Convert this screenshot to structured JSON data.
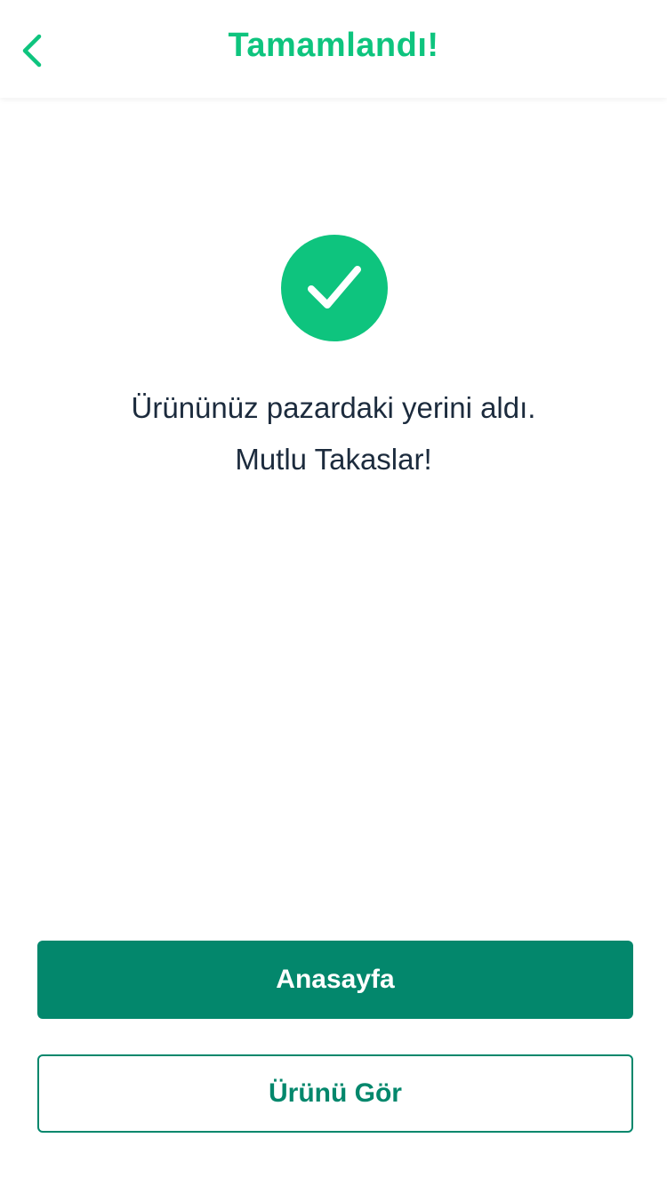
{
  "header": {
    "title": "Tamamlandı!",
    "back_icon": "chevron-left-icon"
  },
  "success": {
    "icon": "checkmark-icon",
    "message_line1": "Ürününüz pazardaki yerini aldı.",
    "message_line2": "Mutlu Takaslar!"
  },
  "actions": {
    "home_label": "Anasayfa",
    "view_product_label": "Ürünü Gör"
  },
  "colors": {
    "accent": "#0ec47e",
    "primary_button": "#03876c",
    "text": "#1c2b3d"
  }
}
